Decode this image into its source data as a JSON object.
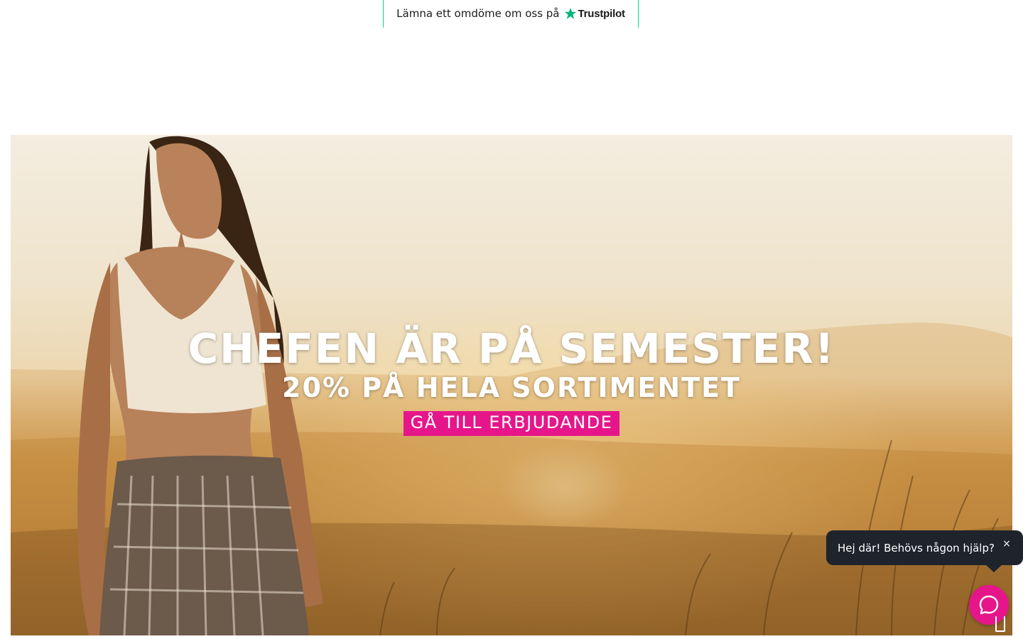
{
  "trustpilot": {
    "text": "Lämna ett omdöme om oss på",
    "brand": "Trustpilot",
    "accent_color": "#00b67a",
    "icon": "star-icon"
  },
  "hero": {
    "title": "CHEFEN ÄR PÅ SEMESTER!",
    "subtitle": "20% PÅ HELA SORTIMENTET",
    "cta_label": "GÅ TILL ERBJUDANDE",
    "cta_color": "#e6168a"
  },
  "chat": {
    "greeting": "Hej där! Behövs någon hjälp?",
    "close_label": "×",
    "close_icon": "close-icon",
    "launcher_icon": "chat-bubble-icon",
    "launcher_color": "#e6168a",
    "bubble_color": "#1f232b"
  }
}
